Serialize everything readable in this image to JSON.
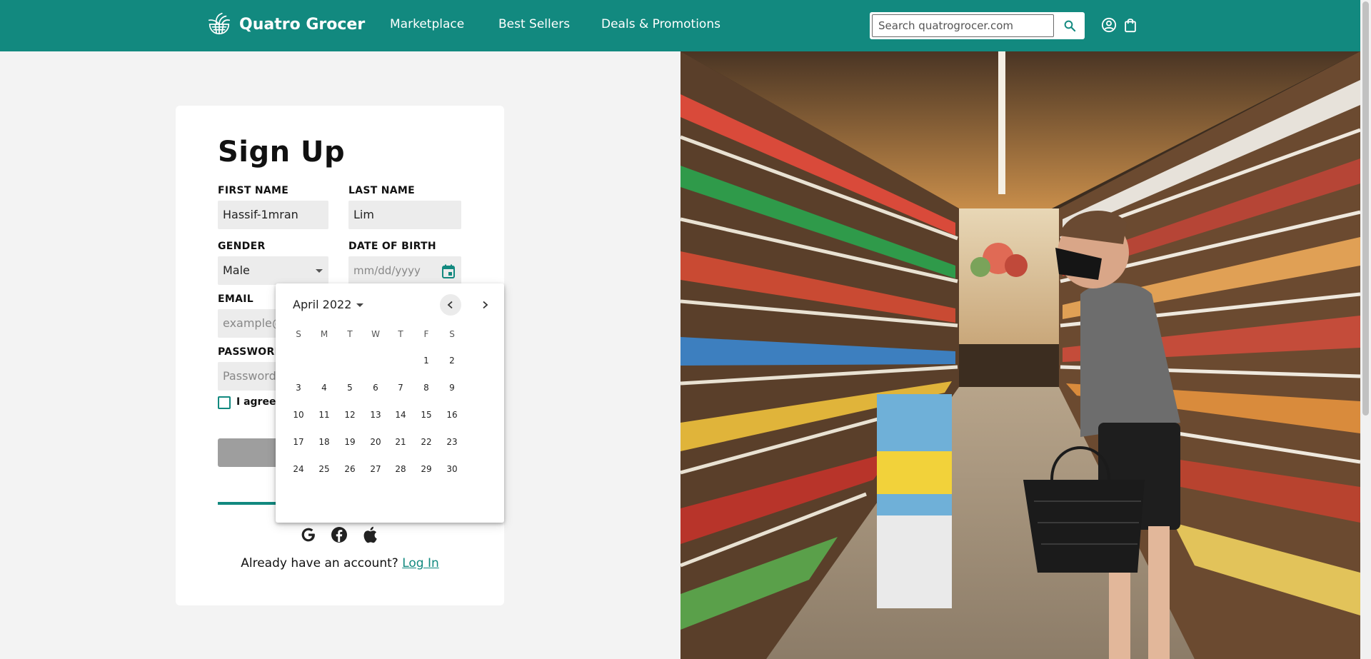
{
  "brand": {
    "name": "Quatro Grocer",
    "accent": "#12897f"
  },
  "nav": {
    "links": [
      "Marketplace",
      "Best Sellers",
      "Deals & Promotions"
    ],
    "search_placeholder": "Search quatrogrocer.com",
    "icons": [
      "search-icon",
      "account-icon",
      "shopping-bag-icon"
    ]
  },
  "signup": {
    "title": "Sign Up",
    "first_name": {
      "label": "FIRST NAME",
      "value": "Hassif-1mran"
    },
    "last_name": {
      "label": "LAST NAME",
      "value": "Lim"
    },
    "gender": {
      "label": "GENDER",
      "value": "Male"
    },
    "dob": {
      "label": "DATE OF BIRTH",
      "placeholder": "mm/dd/yyyy",
      "icon": "calendar-icon"
    },
    "email": {
      "label": "EMAIL",
      "placeholder": "example@"
    },
    "password": {
      "label": "PASSWORD",
      "placeholder": "Password"
    },
    "agree_text": "I agree",
    "social_icons": [
      "google-icon",
      "facebook-icon",
      "apple-icon"
    ],
    "login_prompt": "Already have an account?",
    "login_link": "Log In"
  },
  "datepicker": {
    "month_label": "April 2022",
    "weekdays": [
      "S",
      "M",
      "T",
      "W",
      "T",
      "F",
      "S"
    ],
    "first_weekday_index": 5,
    "days": [
      1,
      2,
      3,
      4,
      5,
      6,
      7,
      8,
      9,
      10,
      11,
      12,
      13,
      14,
      15,
      16,
      17,
      18,
      19,
      20,
      21,
      22,
      23,
      24,
      25,
      26,
      27,
      28,
      29,
      30
    ]
  }
}
